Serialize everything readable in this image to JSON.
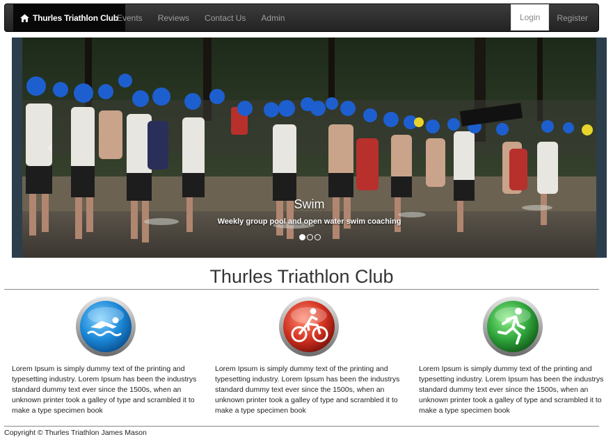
{
  "navbar": {
    "brand": "Thurles Triathlon Club",
    "links": [
      "Events",
      "Reviews",
      "Contact Us",
      "Admin"
    ],
    "login": "Login",
    "register": "Register"
  },
  "carousel": {
    "title": "Swim",
    "subtitle": "Weekly group pool and open water swim coaching",
    "slide_count": 3,
    "active_index": 0
  },
  "main": {
    "heading": "Thurles Triathlon Club",
    "columns": [
      {
        "icon": "swimmer-icon",
        "color": "#1a86d6",
        "text": "Lorem Ipsum is simply dummy text of the printing and typesetting industry. Lorem Ipsum has been the industrys standard dummy text ever since the 1500s, when an unknown printer took a galley of type and scrambled it to make a type specimen book"
      },
      {
        "icon": "cyclist-icon",
        "color": "#d03020",
        "text": "Lorem Ipsum is simply dummy text of the printing and typesetting industry. Lorem Ipsum has been the industrys standard dummy text ever since the 1500s, when an unknown printer took a galley of type and scrambled it to make a type specimen book"
      },
      {
        "icon": "runner-icon",
        "color": "#2ea33a",
        "text": "Lorem Ipsum is simply dummy text of the printing and typesetting industry. Lorem Ipsum has been the industrys standard dummy text ever since the 1500s, when an unknown printer took a galley of type and scrambled it to make a type specimen book"
      }
    ]
  },
  "footer": {
    "copyright": "Copyright © Thurles Triathlon James Mason"
  }
}
